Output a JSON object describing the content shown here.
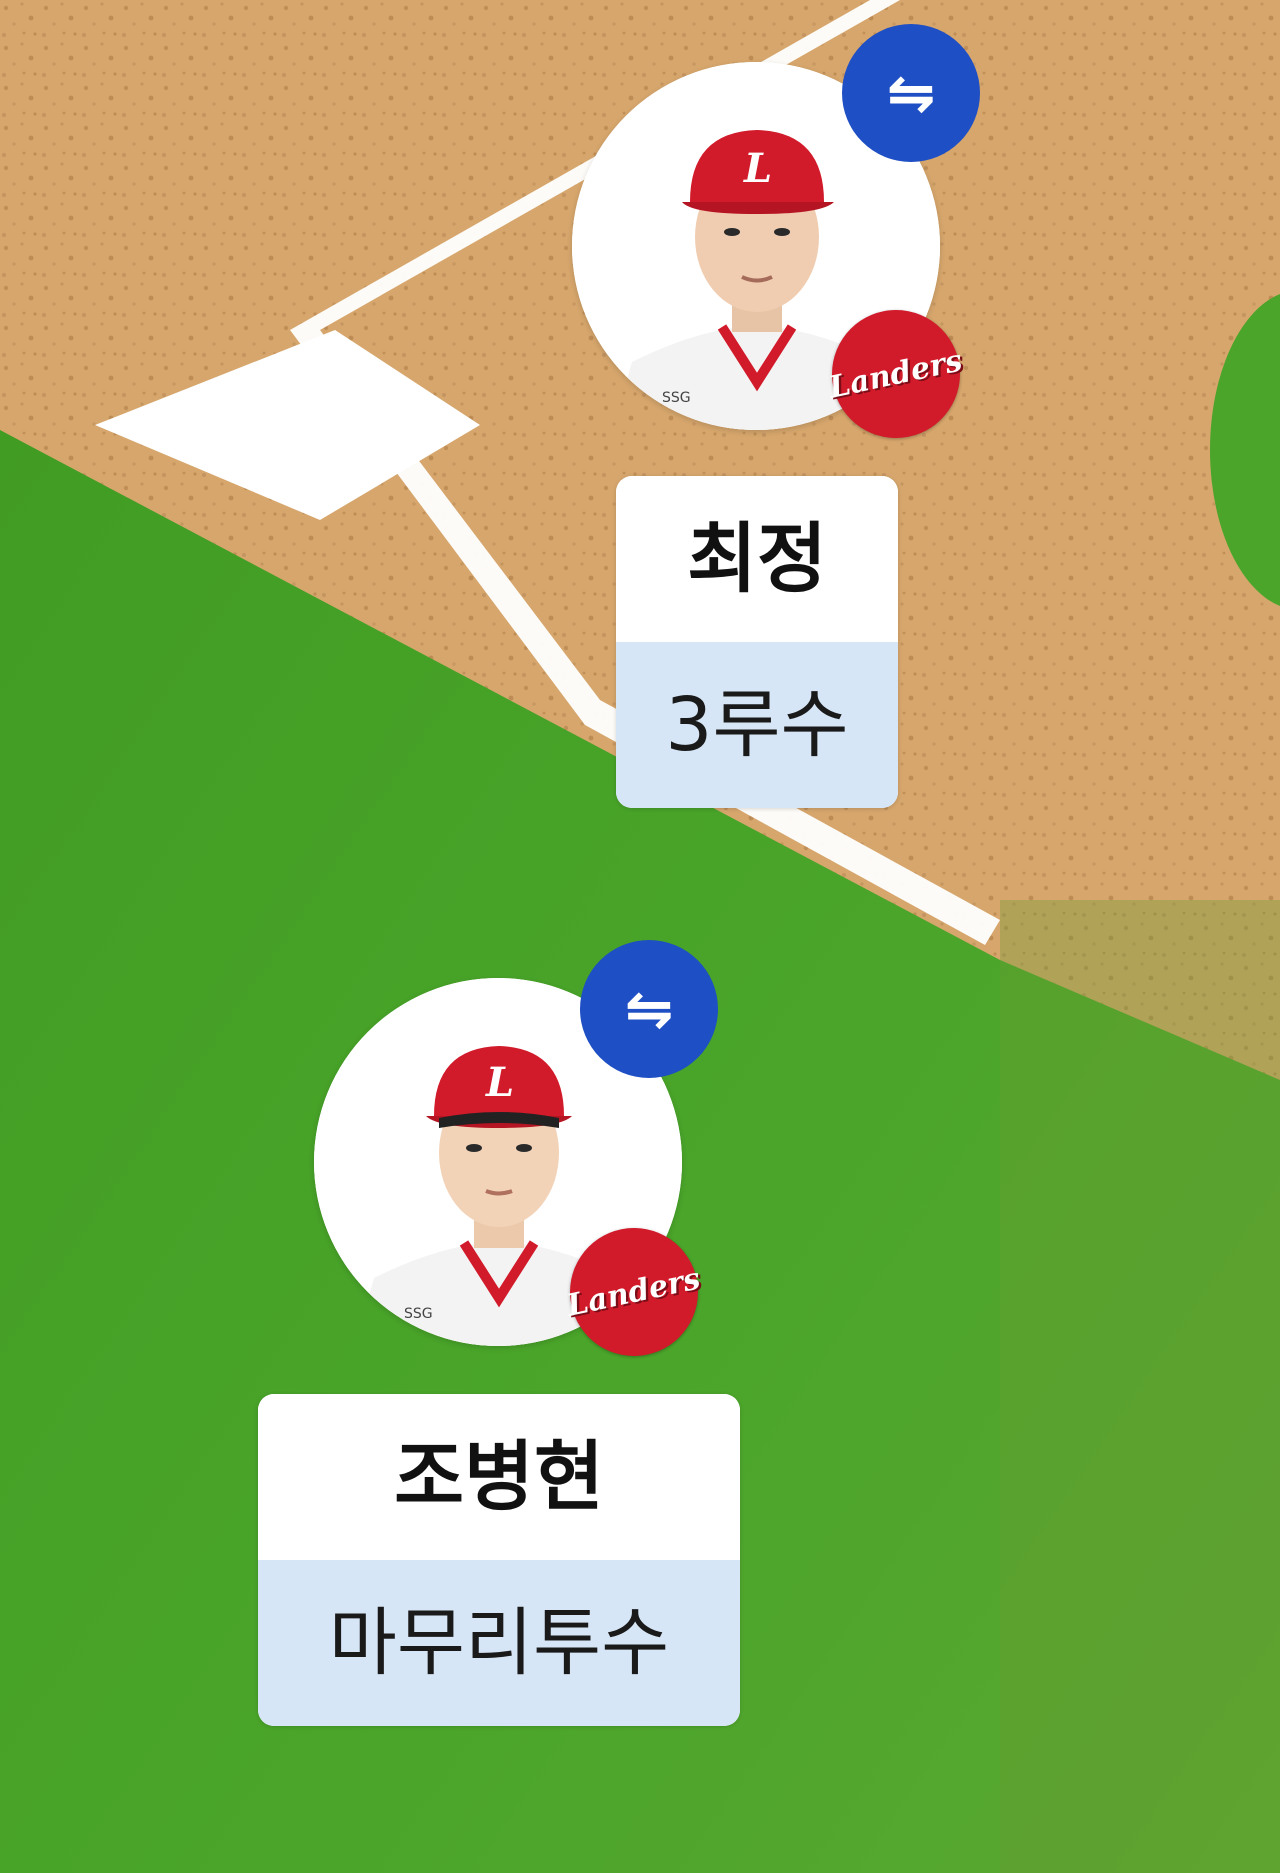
{
  "players": [
    {
      "name": "최정",
      "position": "3루수",
      "team": "Landers",
      "swap_icon": "swap-arrows-icon",
      "swap_symbol": "⇋",
      "jersey_text": "SSG"
    },
    {
      "name": "조병현",
      "position": "마무리투수",
      "team": "Landers",
      "swap_icon": "swap-arrows-icon",
      "swap_symbol": "⇋",
      "jersey_text": "SSG"
    }
  ],
  "colors": {
    "grass": "#4a9e28",
    "dirt": "#d4a46a",
    "swap_button": "#1e4fc4",
    "team_red": "#d11a2a",
    "position_bg": "#d7e6f6"
  }
}
